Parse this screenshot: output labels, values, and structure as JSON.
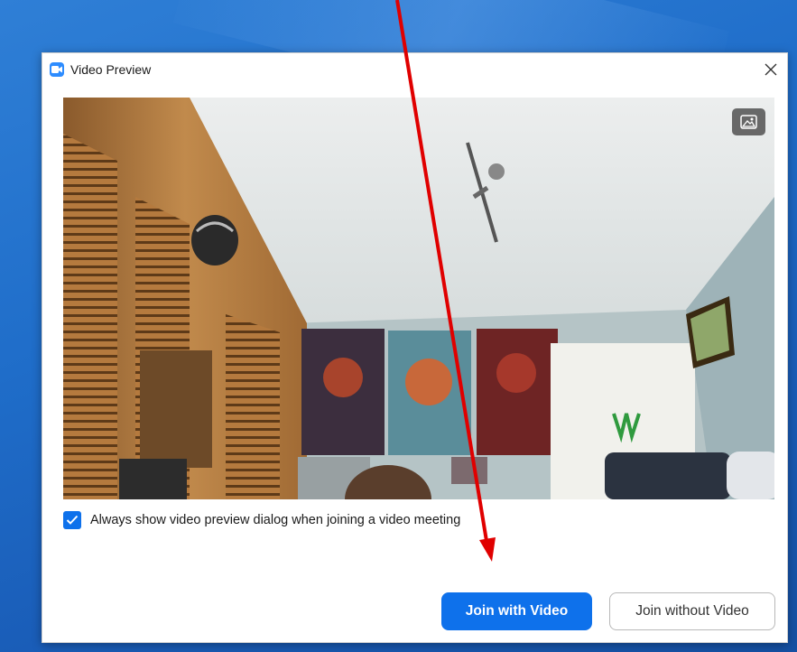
{
  "window": {
    "title": "Video Preview",
    "app_icon": "zoom-camera-icon"
  },
  "video_preview": {
    "background_button_icon": "image-icon"
  },
  "always_show_checkbox": {
    "label": "Always show video preview dialog when joining a video meeting",
    "checked": true
  },
  "buttons": {
    "join_with_video": "Join with Video",
    "join_without_video": "Join without Video"
  },
  "colors": {
    "accent": "#0e71eb",
    "annotation_arrow": "#e00000"
  }
}
